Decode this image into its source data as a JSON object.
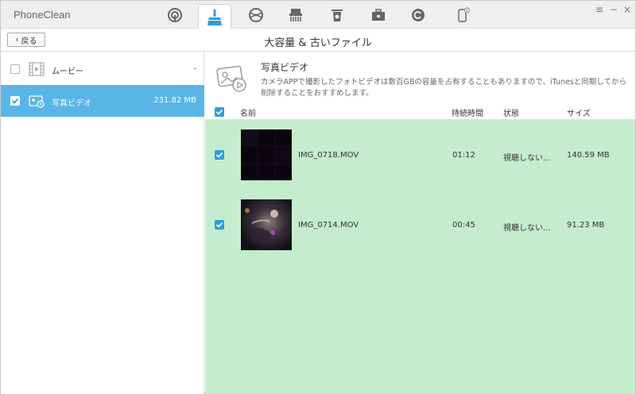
{
  "app": {
    "name": "PhoneClean"
  },
  "window_controls": {
    "menu": "≡",
    "minimize": "−",
    "close": "×"
  },
  "tabs": [
    {
      "name": "quick-clean",
      "icon": "target-icon"
    },
    {
      "name": "deep-clean",
      "icon": "broom-icon",
      "active": true
    },
    {
      "name": "internet-clean",
      "icon": "globe-icon"
    },
    {
      "name": "privacy-clean",
      "icon": "shredder-icon"
    },
    {
      "name": "trash",
      "icon": "trash-icon"
    },
    {
      "name": "toolbox",
      "icon": "toolbox-icon"
    },
    {
      "name": "backup",
      "icon": "refresh-icon"
    },
    {
      "name": "device",
      "icon": "phone-icon",
      "badge": "1"
    }
  ],
  "header": {
    "back_label": "戻る",
    "title": "大容量 & 古いファイル"
  },
  "sidebar": {
    "items": [
      {
        "label": "ムービー",
        "value": "-",
        "checked": false,
        "selected": false,
        "icon": "film-icon"
      },
      {
        "label": "写真ビデオ",
        "value": "231.82 MB",
        "checked": true,
        "selected": true,
        "icon": "photo-video-icon"
      }
    ]
  },
  "info": {
    "title": "写真ビデオ",
    "description": "カメラAPPで撮影したフォトビデオは数百GBの容量を占有することもありますので、iTunesと同期してから削除することをおすすめします。"
  },
  "table": {
    "columns": {
      "name": "名前",
      "duration": "持続時間",
      "status": "状態",
      "size": "サイズ"
    },
    "rows": [
      {
        "name": "IMG_0718.MOV",
        "duration": "01:12",
        "status": "視聴しない...",
        "size": "140.59 MB",
        "checked": true
      },
      {
        "name": "IMG_0714.MOV",
        "duration": "00:45",
        "status": "視聴しない...",
        "size": "91.23 MB",
        "checked": true
      }
    ]
  },
  "colors": {
    "accent": "#2a9ee0",
    "selected_row": "#5ab5e7",
    "list_bg": "#c6ecce"
  }
}
